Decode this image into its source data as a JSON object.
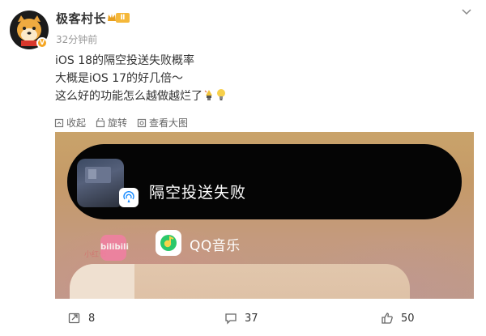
{
  "post": {
    "username": "极客村长",
    "level_badge": "Ⅱ",
    "verified_badge": "V",
    "timestamp": "32分钟前",
    "lines": [
      "iOS 18的隔空投送失败概率",
      "大概是iOS 17的好几倍～",
      "这么好的功能怎么越做越烂了"
    ]
  },
  "actions_small": [
    {
      "label": "收起",
      "icon": "collapse-icon"
    },
    {
      "label": "旋转",
      "icon": "rotate-icon"
    },
    {
      "label": "查看大图",
      "icon": "view-image-icon"
    }
  ],
  "media": {
    "airdrop_text": "隔空投送失败",
    "app_label": "QQ音乐",
    "bili_text": "bilibili",
    "bili_left_text": "小红书"
  },
  "stats": {
    "reposts": "8",
    "comments": "37",
    "likes": "50"
  },
  "colors": {
    "accent": "#f5a623",
    "text": "#333333",
    "muted": "#999999"
  }
}
